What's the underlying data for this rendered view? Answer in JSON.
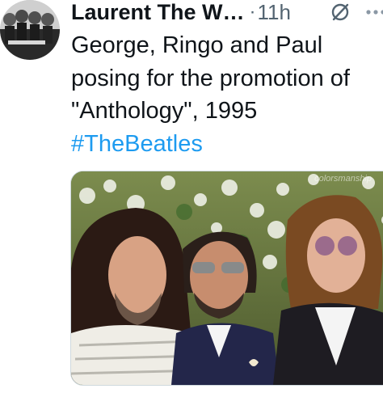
{
  "tweet": {
    "author": "Laurent The W…",
    "separator": "·",
    "time": "11h",
    "text_lines": [
      "George, Ringo and Paul",
      "posing for the promotion of",
      "\"Anthology\", 1995"
    ],
    "hashtag": "#TheBeatles"
  },
  "media": {
    "watermark": "colorsmanship",
    "photo": "George, Ringo and Paul posing outdoors in front of white flowering bushes"
  },
  "icons": {
    "grok": "grok-icon",
    "more": "more-icon"
  },
  "colors": {
    "hashtag": "#1d9bf0",
    "secondary_text": "#536471"
  }
}
